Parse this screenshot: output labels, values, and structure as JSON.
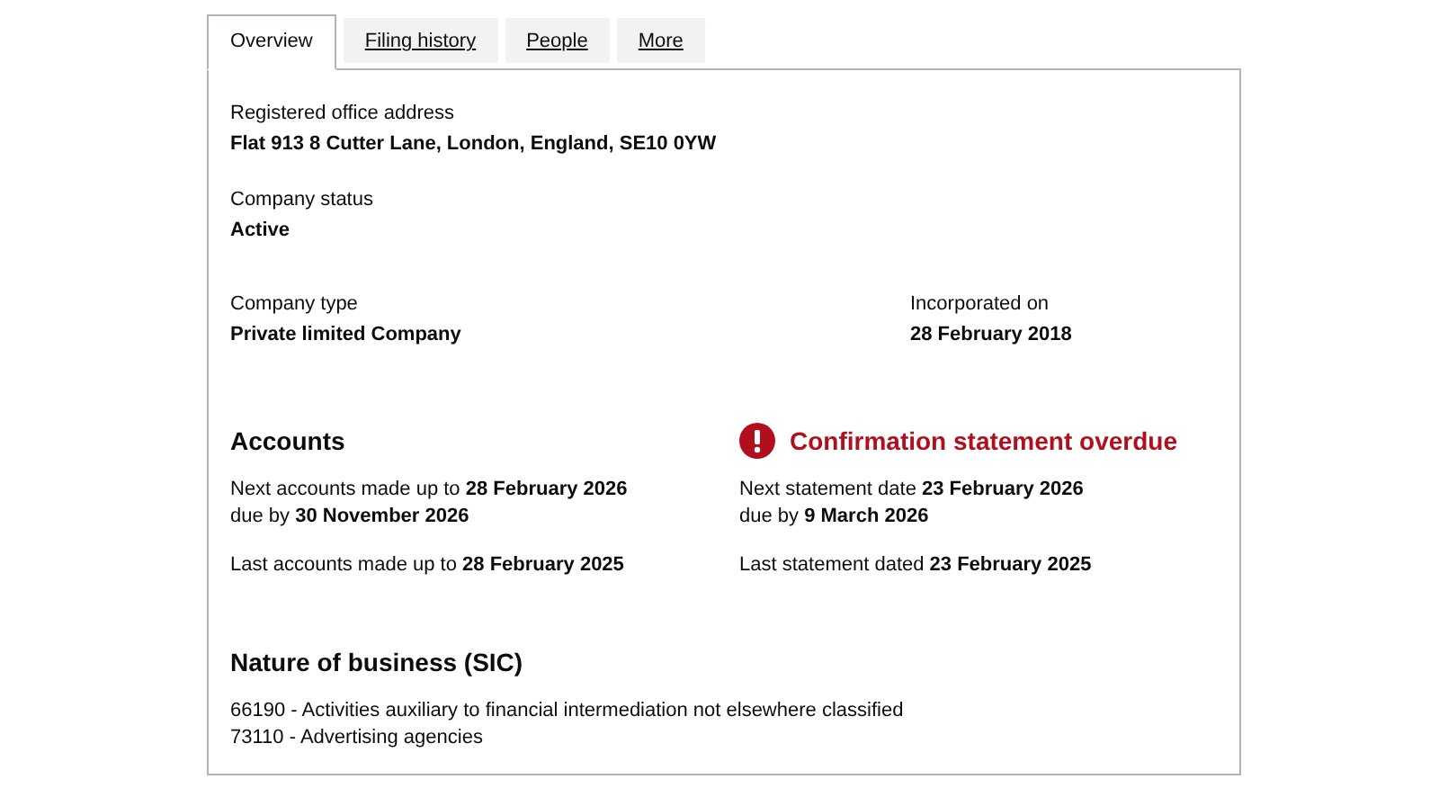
{
  "tabs": [
    {
      "label": "Overview",
      "selected": true
    },
    {
      "label": "Filing history",
      "selected": false
    },
    {
      "label": "People",
      "selected": false
    },
    {
      "label": "More",
      "selected": false
    }
  ],
  "fields": [
    {
      "label": "Registered office address",
      "value": "Flat 913 8 Cutter Lane, London, England, SE10 0YW"
    },
    {
      "label": "Company status",
      "value": "Active"
    }
  ],
  "pair": [
    {
      "label": "Company type",
      "value": "Private limited Company"
    },
    {
      "label": "Incorporated on",
      "value": "28 February 2018"
    }
  ],
  "sections": [
    {
      "heading": "Accounts",
      "overdue": false,
      "groups": [
        [
          "Next accounts made up to **28 February 2026**",
          "due by **30 November 2026**"
        ],
        [
          "Last accounts made up to **28 February 2025**"
        ]
      ]
    },
    {
      "heading": "Confirmation statement overdue",
      "overdue": true,
      "groups": [
        [
          "Next statement date **23 February 2026**",
          "due by **9 March 2026**"
        ],
        [
          "Last statement dated **23 February 2025**"
        ]
      ]
    }
  ],
  "nature": {
    "heading": "Nature of business (SIC)",
    "lines": [
      "66190 - Activities auxiliary to financial intermediation not elsewhere classified",
      "73110 - Advertising agencies"
    ]
  }
}
